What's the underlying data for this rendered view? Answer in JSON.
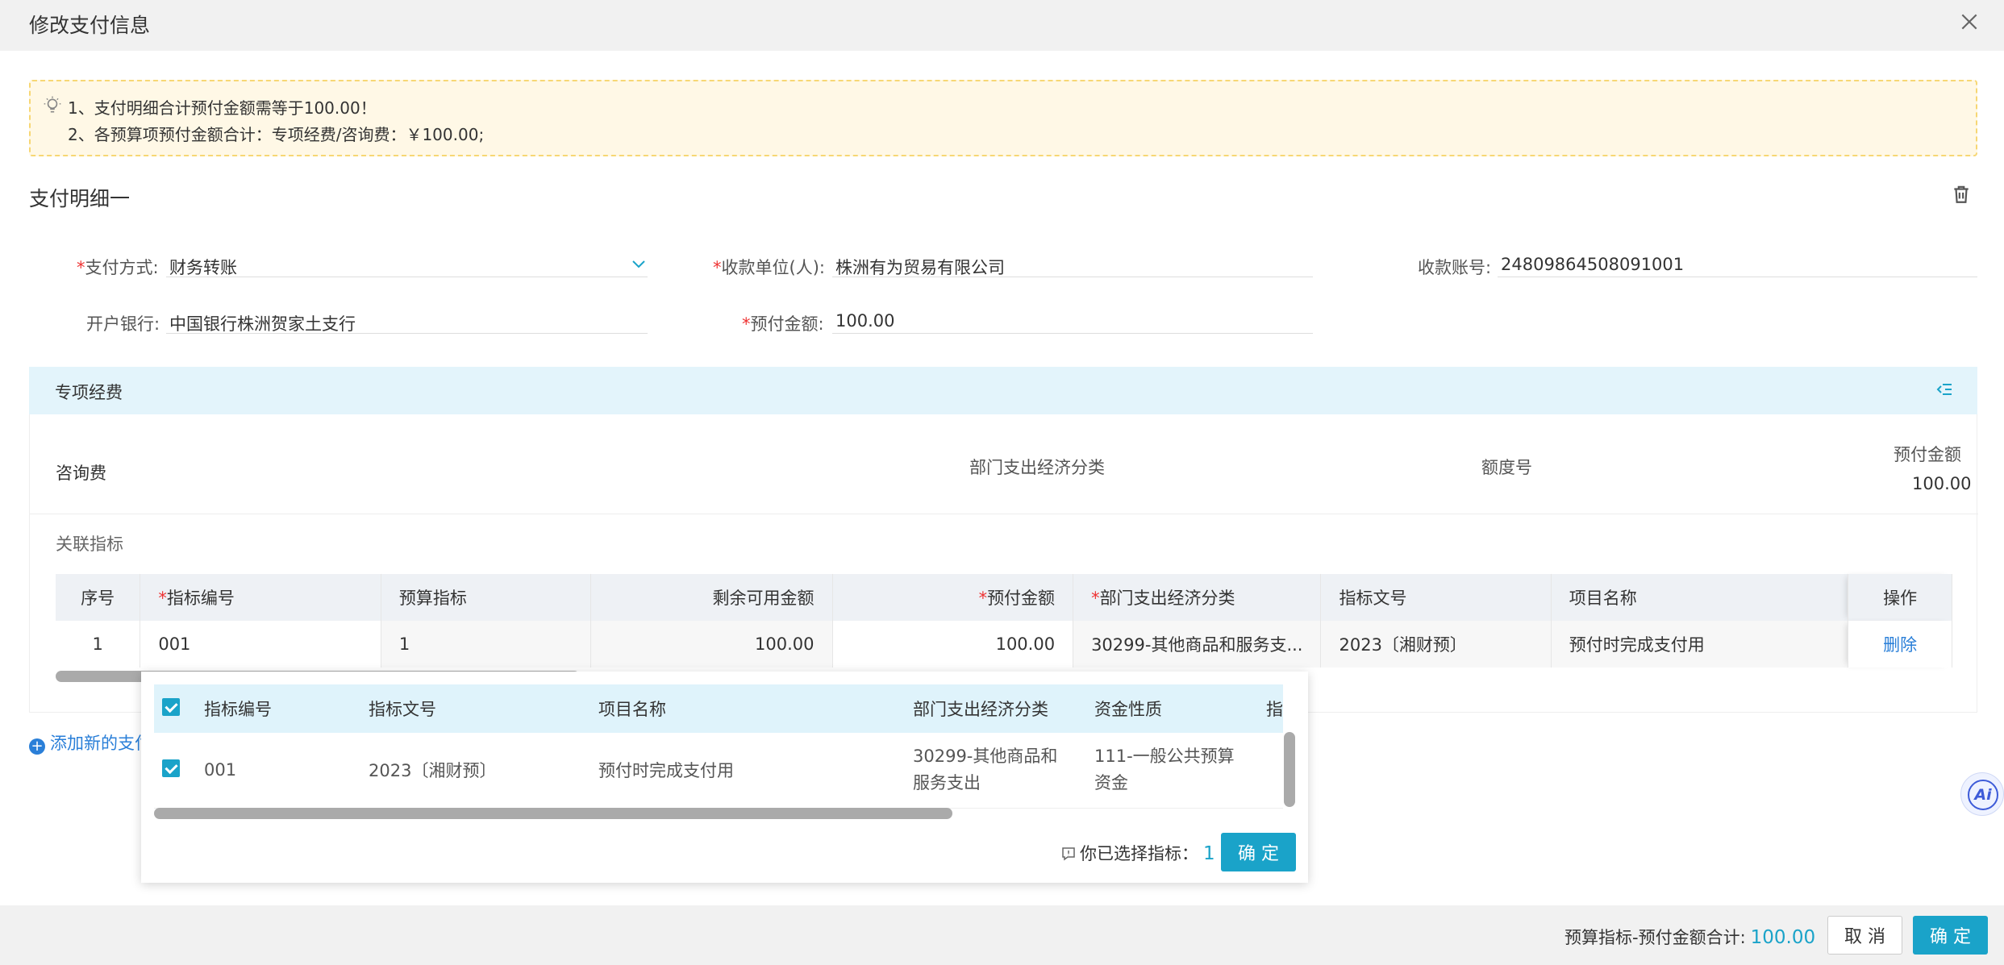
{
  "dialog": {
    "title": "修改支付信息"
  },
  "notice": {
    "line1": "1、支付明细合计预付金额需等于100.00！",
    "line2": "2、各预算项预付金额合计：专项经费/咨询费：￥100.00;"
  },
  "detail": {
    "title": "支付明细一",
    "fields": {
      "pay_method": {
        "label": "支付方式:",
        "value": "财务转账"
      },
      "payee": {
        "label": "收款单位(人):",
        "value": "株洲有为贸易有限公司"
      },
      "account": {
        "label": "收款账号:",
        "value": "24809864508091001"
      },
      "bank": {
        "label": "开户银行:",
        "value": "中国银行株洲贺家土支行"
      },
      "amount": {
        "label": "预付金额:",
        "value": "100.00"
      }
    }
  },
  "fund": {
    "title": "专项经费",
    "item_name": "咨询费",
    "col_econ": "部门支出经济分类",
    "col_quota": "额度号",
    "col_amount": "预付金额",
    "amount_value": "100.00",
    "link_label": "关联指标"
  },
  "grid": {
    "headers": {
      "seq": "序号",
      "code": "指标编号",
      "budget": "预算指标",
      "remain": "剩余可用金额",
      "prepay": "预付金额",
      "econ": "部门支出经济分类",
      "doc": "指标文号",
      "project": "项目名称",
      "op": "操作"
    },
    "row": {
      "seq": "1",
      "code": "001",
      "budget": "1",
      "remain": "100.00",
      "prepay": "100.00",
      "econ": "30299-其他商品和服务支...",
      "doc": "2023〔湘财预〕",
      "project": "预付时完成支付用",
      "op": "删除"
    }
  },
  "add_link": "添加新的支付",
  "popup": {
    "headers": {
      "code": "指标编号",
      "doc": "指标文号",
      "project": "项目名称",
      "econ": "部门支出经济分类",
      "fund": "资金性质",
      "more": "指"
    },
    "row": {
      "code": "001",
      "doc": "2023〔湘财预〕",
      "project": "预付时完成支付用",
      "econ1": "30299-其他商品和",
      "econ2": "服务支出",
      "fund1": "111-一般公共预算",
      "fund2": "资金"
    },
    "selected_label": "你已选择指标：",
    "selected_count": "1",
    "confirm": "确 定"
  },
  "footer": {
    "sum_label": "预算指标-预付金额合计:",
    "sum_value": "100.00",
    "cancel": "取 消",
    "confirm": "确 定"
  },
  "ai_button": "Ai",
  "colors": {
    "accent": "#1aa3c9",
    "link": "#2a7fd8",
    "required": "#ee3333",
    "notice_bg": "#fff8e6",
    "band_bg": "#e3f4fb"
  }
}
